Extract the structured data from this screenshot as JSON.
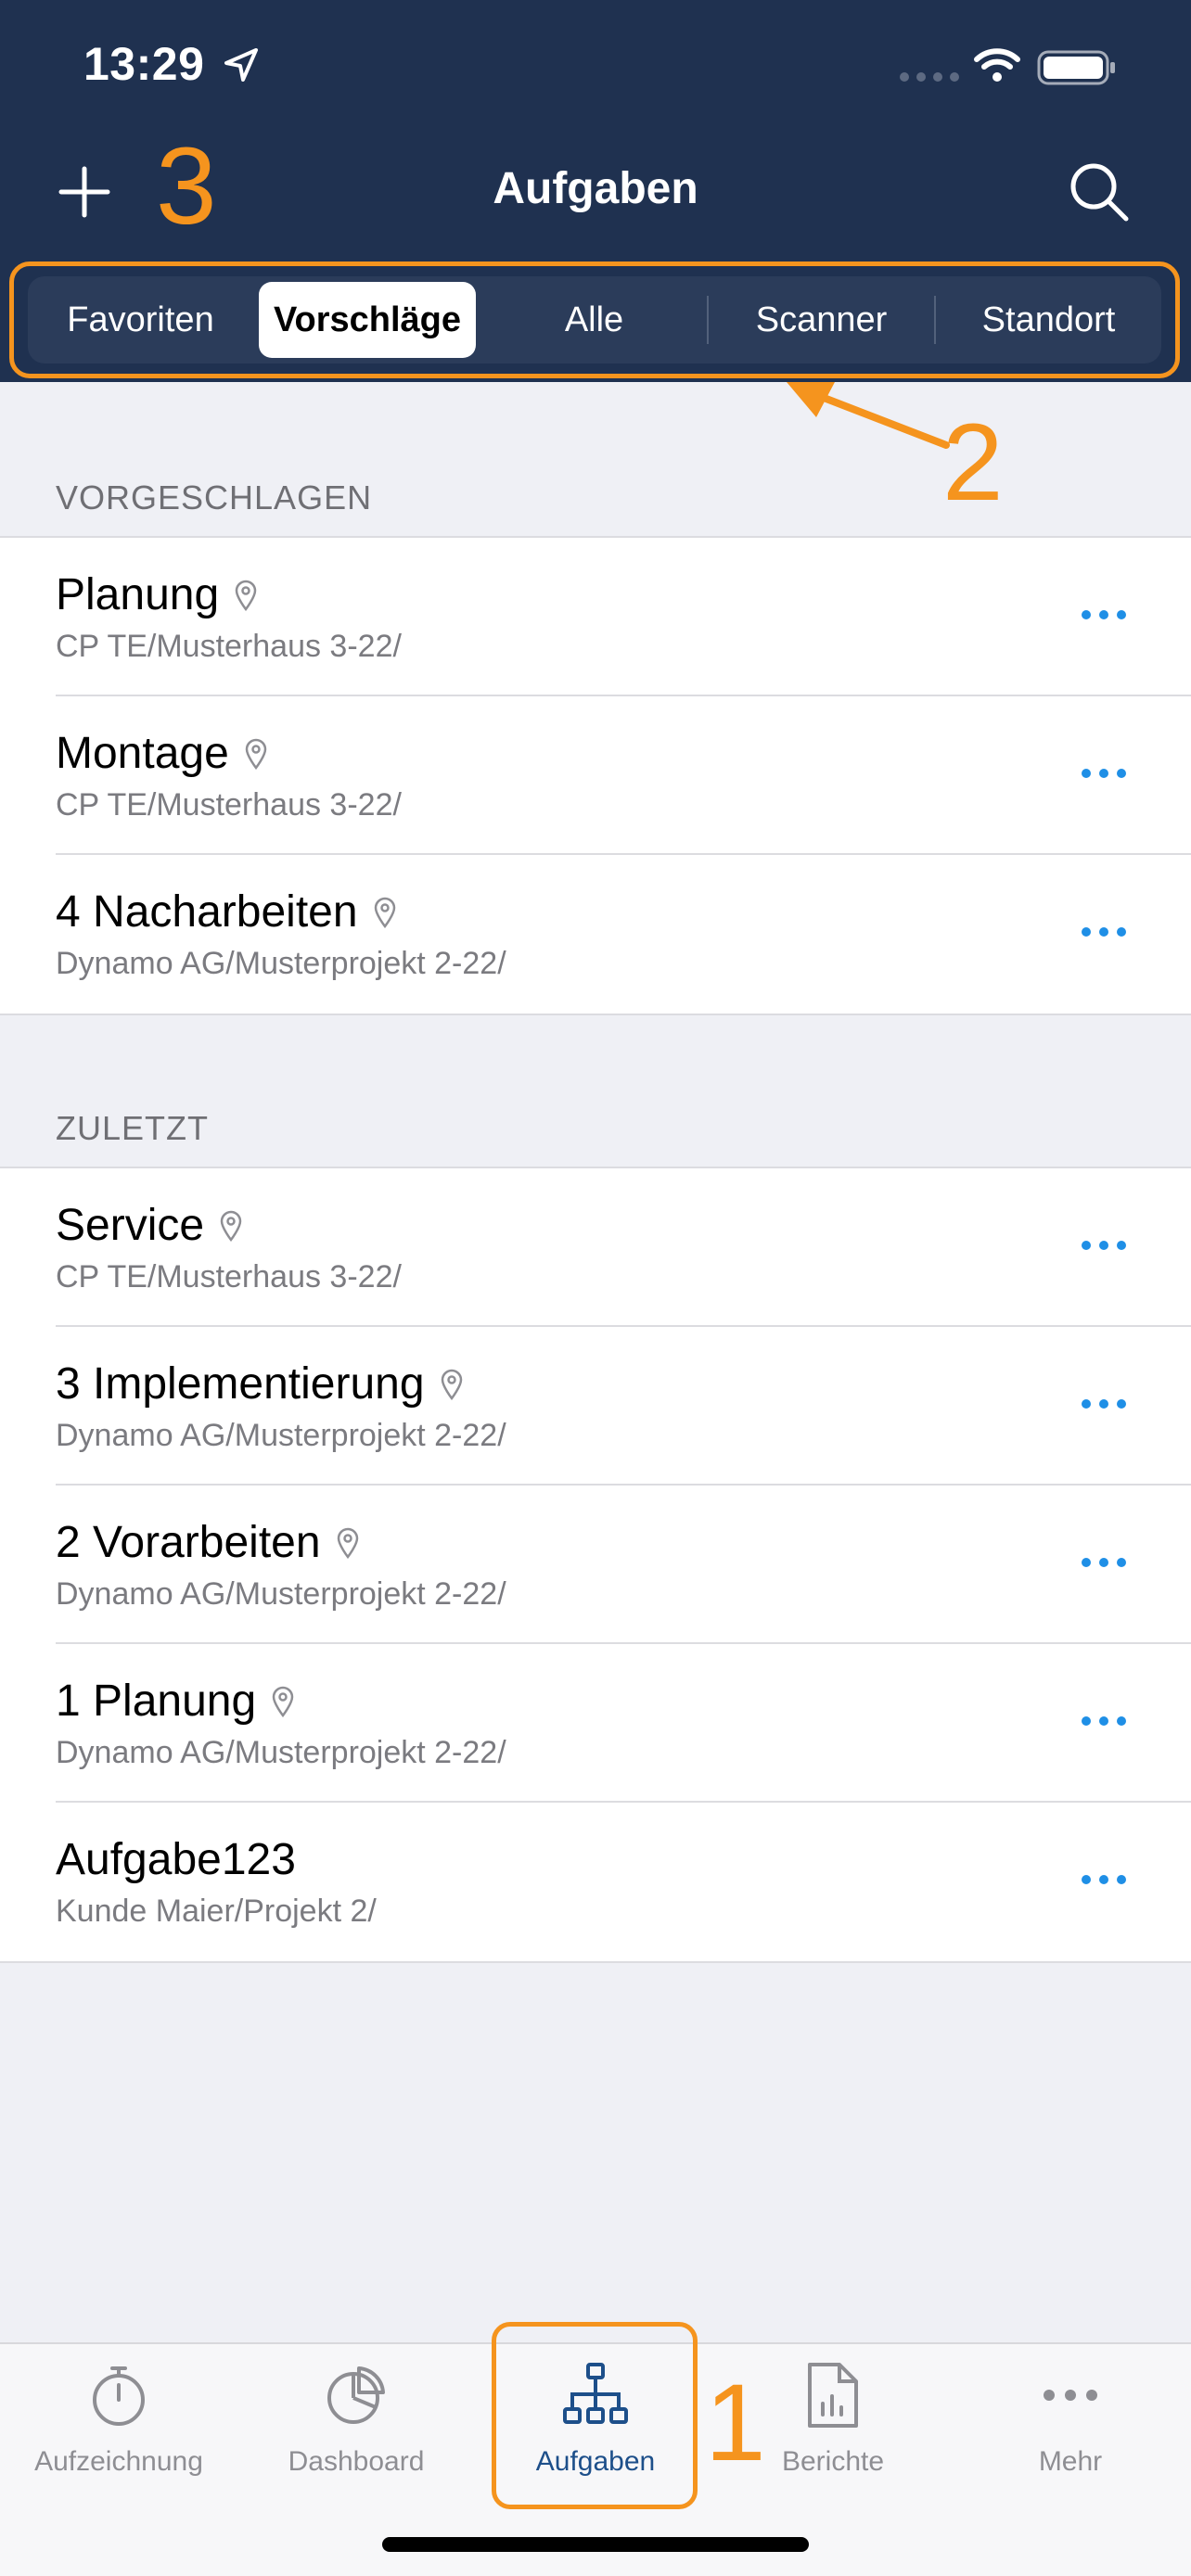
{
  "status": {
    "time": "13:29"
  },
  "nav": {
    "title": "Aufgaben",
    "annotation": "3"
  },
  "segments": [
    {
      "label": "Favoriten",
      "active": false
    },
    {
      "label": "Vorschläge",
      "active": true
    },
    {
      "label": "Alle",
      "active": false
    },
    {
      "label": "Scanner",
      "active": false
    },
    {
      "label": "Standort",
      "active": false
    }
  ],
  "segments_annotation": "2",
  "sections": [
    {
      "header": "VORGESCHLAGEN",
      "items": [
        {
          "title": "Planung",
          "subtitle": "CP TE/Musterhaus 3-22/",
          "has_location": true
        },
        {
          "title": "Montage",
          "subtitle": "CP TE/Musterhaus 3-22/",
          "has_location": true
        },
        {
          "title": "4 Nacharbeiten",
          "subtitle": "Dynamo AG/Musterprojekt 2-22/",
          "has_location": true
        }
      ]
    },
    {
      "header": "ZULETZT",
      "items": [
        {
          "title": "Service",
          "subtitle": "CP TE/Musterhaus 3-22/",
          "has_location": true
        },
        {
          "title": "3 Implementierung",
          "subtitle": "Dynamo AG/Musterprojekt 2-22/",
          "has_location": true
        },
        {
          "title": "2 Vorarbeiten",
          "subtitle": "Dynamo AG/Musterprojekt 2-22/",
          "has_location": true
        },
        {
          "title": "1 Planung",
          "subtitle": "Dynamo AG/Musterprojekt 2-22/",
          "has_location": true
        },
        {
          "title": "Aufgabe123",
          "subtitle": "Kunde Maier/Projekt 2/",
          "has_location": false
        }
      ]
    }
  ],
  "tabs": [
    {
      "label": "Aufzeichnung",
      "icon": "stopwatch-icon",
      "active": false
    },
    {
      "label": "Dashboard",
      "icon": "pie-chart-icon",
      "active": false
    },
    {
      "label": "Aufgaben",
      "icon": "hierarchy-icon",
      "active": true
    },
    {
      "label": "Berichte",
      "icon": "report-icon",
      "active": false
    },
    {
      "label": "Mehr",
      "icon": "more-icon",
      "active": false
    }
  ],
  "tabs_annotation": "1",
  "colors": {
    "header": "#1f3150",
    "accent": "#1f8fe6",
    "annotation": "#f5941e",
    "active_tab": "#1d4f8a"
  }
}
